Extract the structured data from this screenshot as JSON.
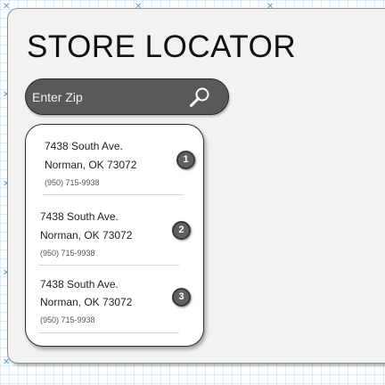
{
  "header": {
    "title": "STORE LOCATOR"
  },
  "search": {
    "placeholder": "Enter Zip",
    "value": "",
    "icon": "search-icon"
  },
  "locations": [
    {
      "index": "1",
      "street": "7438 South Ave.",
      "city": "Norman, OK 73072",
      "phone": "(950) 715-9938"
    },
    {
      "index": "2",
      "street": "7438 South Ave.",
      "city": "Norman, OK 73072",
      "phone": "(950) 715-9938"
    },
    {
      "index": "3",
      "street": "7438 South Ave.",
      "city": "Norman, OK 73072",
      "phone": "(950) 715-9938"
    }
  ],
  "colors": {
    "search_bar": "#595959",
    "badge": "#606060",
    "card_background": "#f2f2f2",
    "grid_guides": "#5aa2d6"
  }
}
